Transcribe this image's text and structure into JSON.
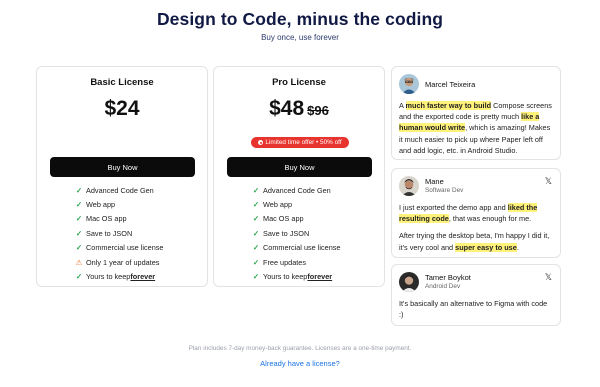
{
  "header": {
    "title": "Design to Code, minus the coding",
    "subtitle": "Buy once, use forever"
  },
  "plans": [
    {
      "name": "Basic License",
      "price": "$24",
      "button": "Buy Now",
      "features": [
        {
          "icon": "check-icon",
          "text": "Advanced Code Gen"
        },
        {
          "icon": "check-icon",
          "text": "Web app"
        },
        {
          "icon": "check-icon",
          "text": "Mac OS app"
        },
        {
          "icon": "check-icon",
          "text": "Save to JSON"
        },
        {
          "icon": "check-icon",
          "text": "Commercial use license"
        },
        {
          "icon": "warning-icon",
          "text": "Only 1 year of updates"
        },
        {
          "icon": "check-icon",
          "text": "Yours to keep ",
          "emphasis": "forever"
        }
      ]
    },
    {
      "name": "Pro License",
      "price": "$48",
      "old_price": "$96",
      "badge": "Limited time offer • 50% off",
      "button": "Buy Now",
      "features": [
        {
          "icon": "check-icon",
          "text": "Advanced Code Gen"
        },
        {
          "icon": "check-icon",
          "text": "Web app"
        },
        {
          "icon": "check-icon",
          "text": "Mac OS app"
        },
        {
          "icon": "check-icon",
          "text": "Save to JSON"
        },
        {
          "icon": "check-icon",
          "text": "Commercial use license"
        },
        {
          "icon": "check-icon",
          "text": "Free updates"
        },
        {
          "icon": "check-icon",
          "text": "Yours to keep ",
          "emphasis": "forever"
        }
      ]
    }
  ],
  "reviews": [
    {
      "name": "Marcel Teixeira",
      "role": "",
      "paragraphs": [
        [
          {
            "t": "A "
          },
          {
            "t": "much faster way to build",
            "hl": true
          },
          {
            "t": " Compose screens and the exported code is pretty much "
          },
          {
            "t": "like a human would write",
            "hl": true
          },
          {
            "t": ", which is amazing! Makes it much easier to pick up where Paper left off and add logic, etc. in Android Studio."
          }
        ]
      ]
    },
    {
      "name": "Mane",
      "role": "Software Dev",
      "source_icon": "x-logo-icon",
      "paragraphs": [
        [
          {
            "t": "I just exported the demo app and "
          },
          {
            "t": "liked the resulting code",
            "hl": true
          },
          {
            "t": ", that was enough for me."
          }
        ],
        [
          {
            "t": "After trying the desktop beta, I'm happy I did it, it's very cool and "
          },
          {
            "t": "super easy to use",
            "hl": true
          },
          {
            "t": "."
          }
        ]
      ]
    },
    {
      "name": "Tamer Boykot",
      "role": "Android Dev",
      "source_icon": "x-logo-icon",
      "paragraphs": [
        [
          {
            "t": "It's basically an alternative to Figma with code :)"
          }
        ]
      ]
    }
  ],
  "footer": {
    "guarantee": "Plan includes 7-day money-back guarantee. Licenses are a one-time payment.",
    "login_link": "Already have a license?"
  },
  "colors": {
    "accent_text": "#111a44",
    "button_bg": "#0b0b0b",
    "badge_bg": "#e8342f",
    "check": "#2ea44f",
    "warning": "#e8782f",
    "highlight": "#fff27a",
    "link": "#1a73e8"
  }
}
